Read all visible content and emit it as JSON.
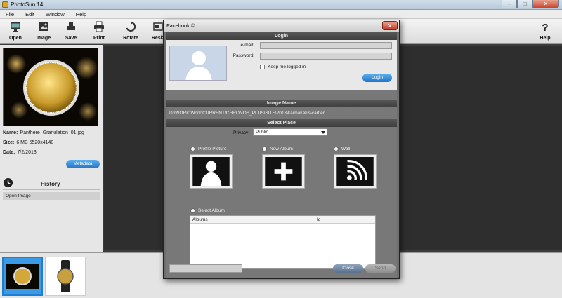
{
  "app": {
    "title": "PhotoSun 14"
  },
  "menu": [
    "File",
    "Edit",
    "Window",
    "Help"
  ],
  "toolbar": {
    "open": "Open",
    "image": "Image",
    "save": "Save",
    "print": "Print",
    "rotate": "Rotate",
    "resize": "Resiz",
    "help": "Help"
  },
  "left_panel": {
    "name_label": "Name:",
    "name_value": "Panthere_Granulation_01.jpg",
    "size_label": "Size:",
    "size_value": "6 MB  5520x4140",
    "date_label": "Date:",
    "date_value": "7/2/2013",
    "metadata_button": "Metadata",
    "history_title": "History",
    "history_items": [
      "Open Image"
    ]
  },
  "dialog": {
    "title": "Facebook ©",
    "close_glyph": "x",
    "login_header": "Login",
    "email_label": "e-mail:",
    "email_value": "",
    "password_label": "Password:",
    "password_value": "",
    "keep_logged": "Keep me logged in",
    "login_button": "Login",
    "image_name_header": "Image Name",
    "image_path": "D:\\WORK\\Work\\CURRENT\\CHRONOS_PLUS\\SITE\\2013\\kaimakakis\\cartier",
    "select_place_header": "Select Place",
    "privacy_label": "Privacy:",
    "privacy_value": "Public",
    "places": [
      "Profile Picture",
      "New Album",
      "Wall"
    ],
    "select_album": "Select Album",
    "albums_columns": [
      "Albums",
      "Id"
    ],
    "close_button": "Close",
    "send_button": "Send"
  },
  "colors": {
    "accent_blue": "#2575c4",
    "dialog_bg": "#787878",
    "header_dark": "#3e3e3e",
    "close_red": "#c43a26"
  }
}
